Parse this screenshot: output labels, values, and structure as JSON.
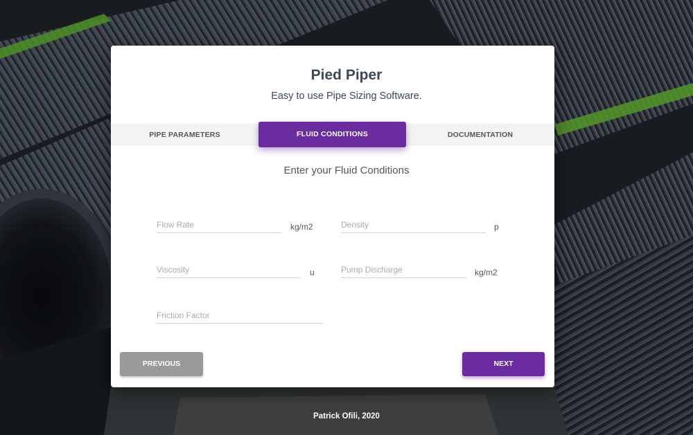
{
  "app": {
    "title": "Pied Piper",
    "subtitle": "Easy to use Pipe Sizing Software."
  },
  "tabs": [
    {
      "label": "PIPE PARAMETERS",
      "active": false
    },
    {
      "label": "FLUID CONDITIONS",
      "active": true
    },
    {
      "label": "DOCUMENTATION",
      "active": false
    }
  ],
  "form": {
    "heading": "Enter your Fluid Conditions",
    "fields": {
      "flow_rate": {
        "placeholder": "Flow Rate",
        "value": "",
        "unit": "kg/m2"
      },
      "density": {
        "placeholder": "Density",
        "value": "",
        "unit": "p"
      },
      "viscosity": {
        "placeholder": "Viscosity",
        "value": "",
        "unit": "u"
      },
      "pump_discharge": {
        "placeholder": "Pump Discharge",
        "value": "",
        "unit": "kg/m2"
      },
      "friction_factor": {
        "placeholder": "Friction Factor",
        "value": ""
      }
    }
  },
  "buttons": {
    "previous": "PREVIOUS",
    "next": "NEXT"
  },
  "footer": {
    "text": "Patrick Ofili, 2020"
  },
  "colors": {
    "accent": "#6a2c9e",
    "button_secondary": "#9a9a9a",
    "text_dark": "#3c4858"
  },
  "background": {
    "icon": "corrugated-pipes-photo"
  }
}
